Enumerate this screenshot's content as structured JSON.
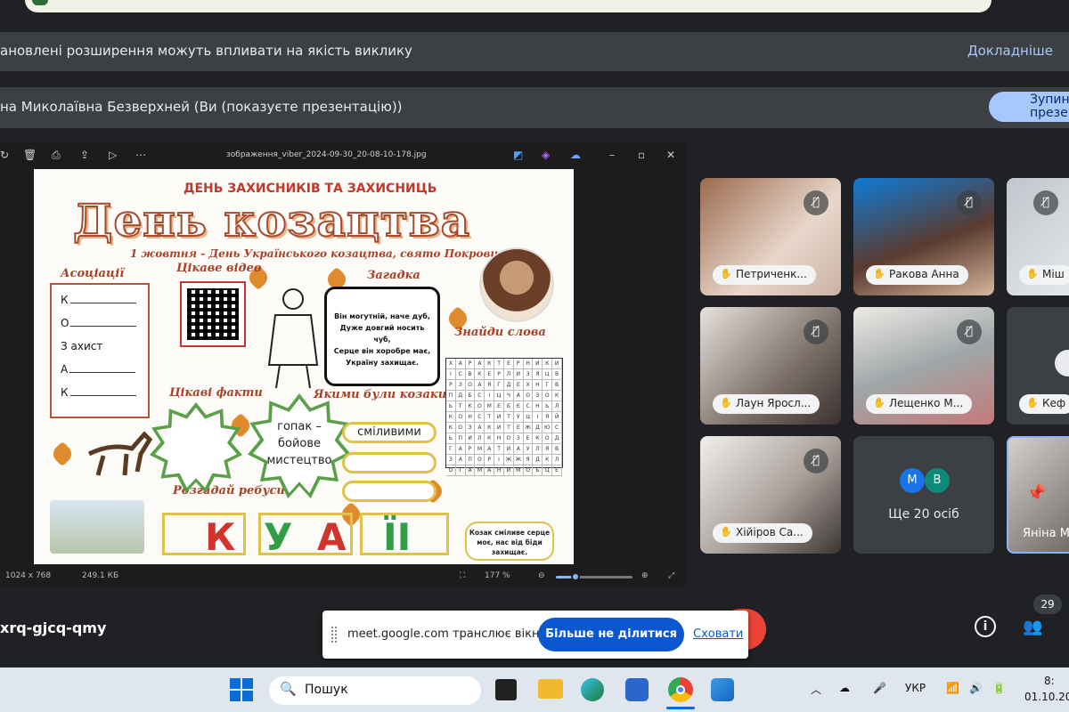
{
  "extensions_banner": {
    "message": "ановлені розширення можуть впливати на якість виклику",
    "link": "Докладніше"
  },
  "presenting_bar": {
    "message": "на Миколаївна Безверхней (Ви (показуєте презентацію))",
    "stop_button": "Зупин презен"
  },
  "viewer": {
    "filename": "зображення_viber_2024-09-30_20-08-10-178.jpg",
    "dimensions": "1024 x 768",
    "filesize": "249.1 КБ",
    "zoom_label": "177 %",
    "zoom_fraction": 0.25,
    "icons": [
      "rotate-icon",
      "delete-icon",
      "print-icon",
      "share-icon",
      "slideshow-icon",
      "more-icon",
      "edit-icon",
      "copilot-icon",
      "cloud-icon",
      "minimize-icon",
      "maximize-icon",
      "close-icon"
    ]
  },
  "poster": {
    "top_title": "ДЕНЬ ЗАХИСНИКІВ ТА ЗАХИСНИЦЬ",
    "big_title": "День козацтва",
    "subtitle": "1 жовтня - День Українського козацтва, свято Покрови",
    "heading_assoc": "Асоціації",
    "heading_video": "Цікаве відео",
    "heading_riddle": "Загадка",
    "heading_words": "Знайди слова",
    "heading_facts": "Цікаві факти",
    "heading_what": "Якими були козаки?",
    "heading_rebus": "Розгадай ребуси",
    "assoc_letters": [
      "К",
      "О",
      "З",
      "А",
      "К"
    ],
    "assoc_written": "ахист",
    "riddle_lines": [
      "Він могутній, наче дуб,",
      "Дуже довгий носить чуб,",
      "Серце він хоробре має,",
      "Україну захищає."
    ],
    "fact_text": "гопак – бойове мистецтво",
    "answer_1": "сміливими",
    "kozak_text": "Козак сміливе серце моє, нас від біди захищає.",
    "rebus_letters": [
      "К",
      "У",
      "А",
      "ЇІ"
    ],
    "word_grid": [
      "ХАРАКТЕРНИКИ",
      "ІСВКЕРЛИЗЯЦВ",
      "РЗОАЯГДЕХНГВ",
      "ПДБСІЦЧАОЗОК",
      "ЬТКОМЕБЄСНЬЛ",
      "КОНСТИТУЦІЯЙ",
      "КОЗАКИТЕЖДЮС",
      "ЬПИЛКНОЗЕКОД",
      "ГАРМАТИАУЛЯВ",
      "ЗАПОРІЖЖЯДКЛ",
      "ОТАМАНИМОЬЦЕ"
    ]
  },
  "participants": [
    {
      "name": "Петриченк...",
      "muted": true
    },
    {
      "name": "Ракова Анна",
      "muted": true
    },
    {
      "name": "Міш",
      "muted": true
    },
    {
      "name": "Лаун Яросл...",
      "muted": true
    },
    {
      "name": "Лещенко М...",
      "muted": true
    },
    {
      "name": "Кеф",
      "muted": false
    },
    {
      "name": "Хійіров Са...",
      "muted": true
    },
    {
      "name": "Ще 20 осіб",
      "avatars": [
        "М",
        "В"
      ]
    },
    {
      "name": "Яніна М",
      "muted": false
    }
  ],
  "bottom_bar": {
    "meeting_code": "xrq-gjcq-qmy",
    "people_count": "29"
  },
  "share_popup": {
    "message": "meet.google.com транслює вікно.",
    "stop_button": "Більше не ділитися",
    "hide_link": "Сховати"
  },
  "taskbar": {
    "search_placeholder": "Пошук",
    "language": "УКР",
    "time": "8:",
    "date": "01.10.20"
  },
  "colors": {
    "meet_bg": "#202124",
    "accent_blue": "#0b57d0",
    "poster_red": "#c0392b"
  }
}
